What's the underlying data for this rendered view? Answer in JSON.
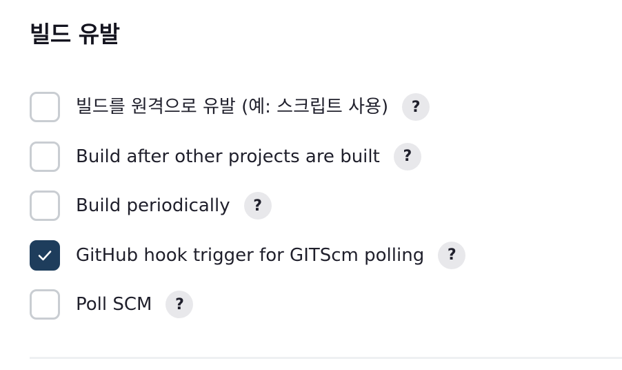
{
  "section": {
    "title": "빌드 유발"
  },
  "options": [
    {
      "label": "빌드를 원격으로 유발 (예: 스크립트 사용)",
      "checked": false,
      "help": "?"
    },
    {
      "label": "Build after other projects are built",
      "checked": false,
      "help": "?"
    },
    {
      "label": "Build periodically",
      "checked": false,
      "help": "?"
    },
    {
      "label": "GitHub hook trigger for GITScm polling",
      "checked": true,
      "help": "?"
    },
    {
      "label": "Poll SCM",
      "checked": false,
      "help": "?"
    }
  ],
  "icons": {
    "checkmark": "check-icon",
    "help": "question-mark-icon"
  },
  "colors": {
    "checked_fill": "#1e3d5c",
    "unchecked_border": "#c9cdd2",
    "help_bg": "#e8e8eb"
  }
}
